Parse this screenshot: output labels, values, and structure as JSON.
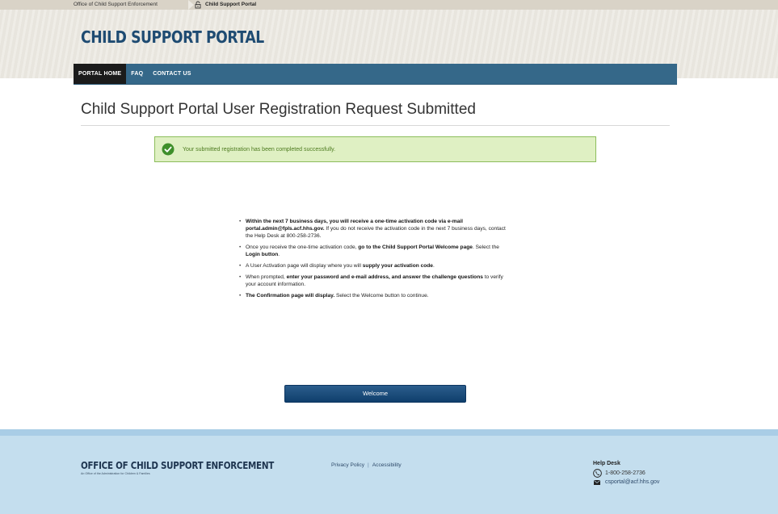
{
  "header": {
    "breadcrumb": {
      "first": "Office of Child Support Enforcement",
      "second": "Child Support Portal"
    },
    "portal_title": "CHILD SUPPORT PORTAL",
    "nav": [
      {
        "label": "PORTAL HOME",
        "active": true
      },
      {
        "label": "FAQ",
        "active": false
      },
      {
        "label": "CONTACT US",
        "active": false
      }
    ]
  },
  "main": {
    "page_title": "Child Support Portal User Registration Request Submitted",
    "success_message": "Your submitted registration has been completed successfully.",
    "instructions": [
      {
        "parts": [
          {
            "text": "Within the next 7 business days, you will receive a one-time activation code via e-mail portal.admin@fpls.acf.hhs.gov.",
            "bold": true
          },
          {
            "text": " If you do not receive the activation code in the next 7 business days, contact the Help Desk at 800-258-2736.",
            "bold": false
          }
        ]
      },
      {
        "parts": [
          {
            "text": "Once you receive the one-time activation code, ",
            "bold": false
          },
          {
            "text": "go to the Child Support Portal Welcome page",
            "bold": true
          },
          {
            "text": ". Select the ",
            "bold": false
          },
          {
            "text": "Login button",
            "bold": true
          },
          {
            "text": ".",
            "bold": false
          }
        ]
      },
      {
        "parts": [
          {
            "text": "A User Activation page will display where you will ",
            "bold": false
          },
          {
            "text": "supply your activation code",
            "bold": true
          },
          {
            "text": ".",
            "bold": false
          }
        ]
      },
      {
        "parts": [
          {
            "text": "When prompted, ",
            "bold": false
          },
          {
            "text": "enter your password and e-mail address, and answer the challenge questions",
            "bold": true
          },
          {
            "text": " to verify your account information.",
            "bold": false
          }
        ]
      },
      {
        "parts": [
          {
            "text": "The Confirmation page will display.",
            "bold": true
          },
          {
            "text": " Select the Welcome button to continue.",
            "bold": false
          }
        ]
      }
    ],
    "welcome_button": "Welcome"
  },
  "footer": {
    "org_title": "OFFICE OF CHILD SUPPORT ENFORCEMENT",
    "org_subtitle": "An Office of the Administration for Children & Families",
    "links": {
      "privacy": "Privacy Policy",
      "separator": "|",
      "accessibility": "Accessibility"
    },
    "helpdesk": {
      "title": "Help Desk",
      "phone": "1-800-258-2736",
      "email": "csportal@acf.hhs.gov"
    }
  },
  "icons": {
    "lock": "lock-icon",
    "check": "check-circle-icon",
    "phone": "phone-icon",
    "mail": "mail-icon"
  },
  "colors": {
    "nav_bar": "#356889",
    "nav_active": "#1b1b1b",
    "title_blue": "#1e4b72",
    "success_bg": "#dff0c3",
    "success_border": "#8cbd5c",
    "success_icon": "#3e8f2a",
    "button": "#1a4a78",
    "footer_bg": "#c4deee"
  }
}
